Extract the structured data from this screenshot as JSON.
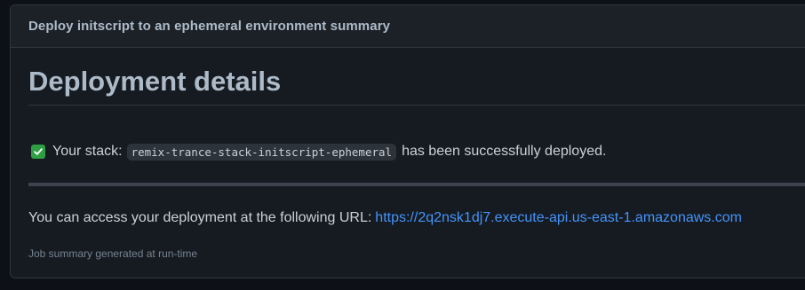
{
  "summary": {
    "header_title": "Deploy initscript to an ephemeral environment summary",
    "heading": "Deployment details",
    "stack_prefix": "Your stack:",
    "stack_name": "remix-trance-stack-initscript-ephemeral",
    "stack_suffix": "has been successfully deployed.",
    "access_text": "You can access your deployment at the following URL:",
    "url": "https://2q2nsk1dj7.execute-api.us-east-1.amazonaws.com",
    "footnote": "Job summary generated at run-time"
  },
  "icons": {
    "status": "check-mark-icon"
  },
  "colors": {
    "background": "#0d1117",
    "panel": "#161b22",
    "header": "#1c2128",
    "check": "#2ea043",
    "link": "#4493f8"
  }
}
